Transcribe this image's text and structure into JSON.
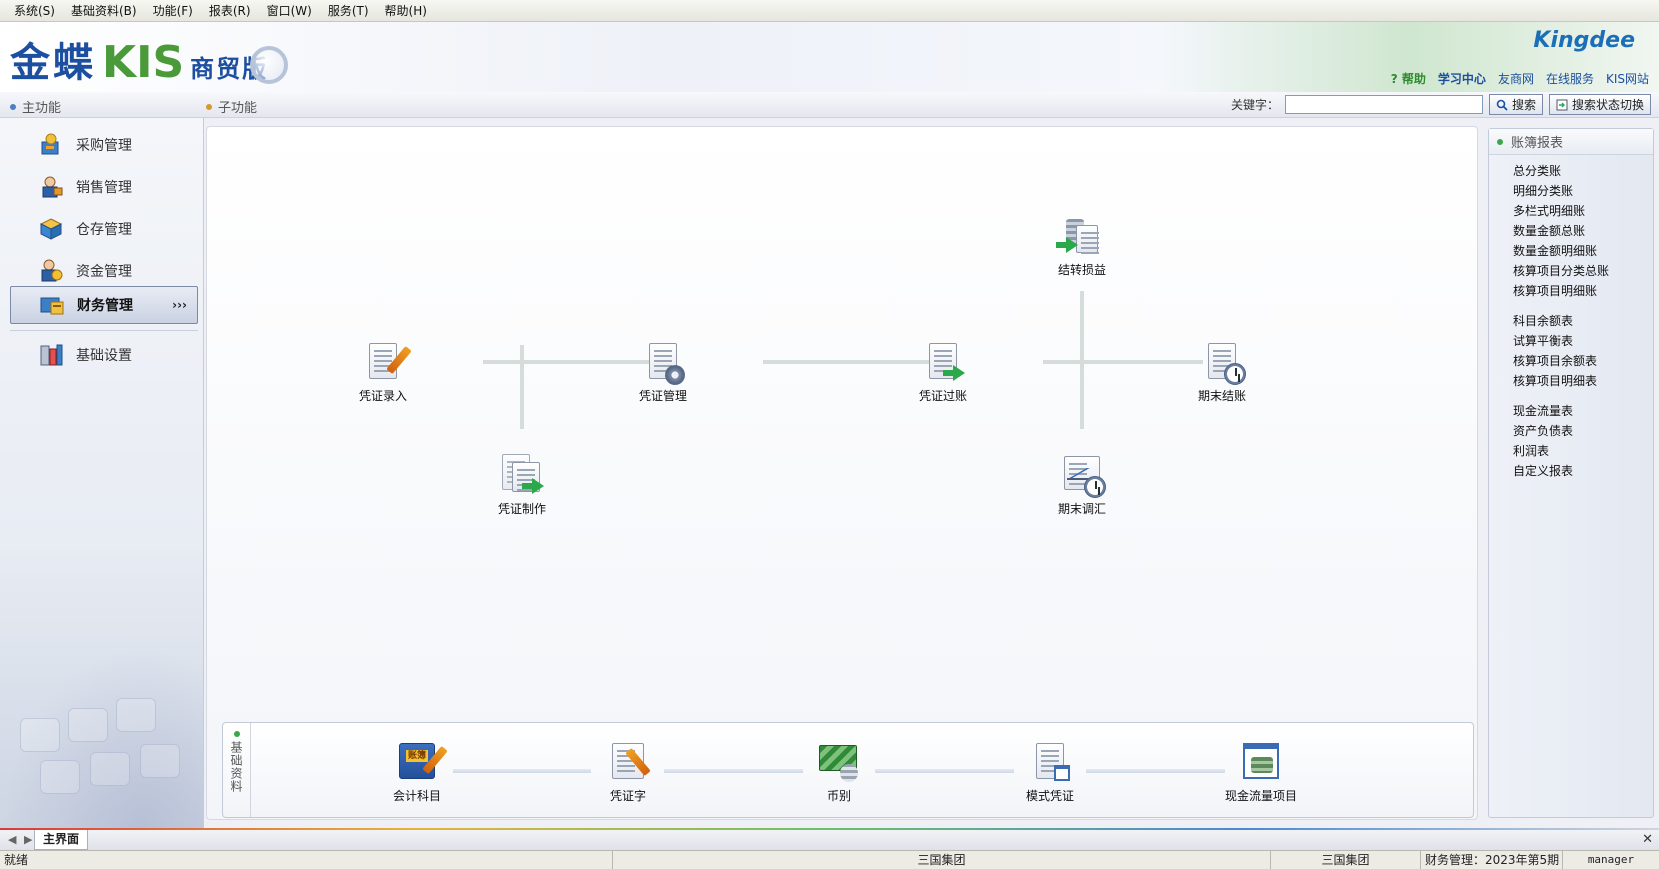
{
  "menu": [
    "系统(S)",
    "基础资料(B)",
    "功能(F)",
    "报表(R)",
    "窗口(W)",
    "服务(T)",
    "帮助(H)"
  ],
  "header": {
    "logo_main": "金蝶",
    "logo_kis": "KIS",
    "logo_edition": "商贸版",
    "brand": "Kingdee",
    "links": [
      "? 帮助",
      "学习中心",
      "友商网",
      "在线服务",
      "KIS网站"
    ]
  },
  "subbar": {
    "main_func": "主功能",
    "sub_func": "子功能",
    "keyword_label": "关键字：",
    "search_value": "",
    "search_button": "搜索",
    "toggle_button": "搜索状态切换"
  },
  "sidebar": {
    "items": [
      {
        "label": "采购管理",
        "icon": "purchase-icon"
      },
      {
        "label": "销售管理",
        "icon": "sales-icon"
      },
      {
        "label": "仓存管理",
        "icon": "inventory-icon"
      },
      {
        "label": "资金管理",
        "icon": "funds-icon"
      },
      {
        "label": "财务管理",
        "icon": "finance-icon",
        "active": true,
        "chevron": "›››"
      },
      {
        "label": "基础设置",
        "icon": "settings-icon"
      }
    ]
  },
  "flow": {
    "nodes": {
      "voucher_entry": "凭证录入",
      "voucher_make": "凭证制作",
      "voucher_manage": "凭证管理",
      "voucher_post": "凭证过账",
      "transfer_pl": "结转损益",
      "period_adjust": "期末调汇",
      "period_close": "期末结账"
    }
  },
  "base_data": {
    "title": "基础资料",
    "items": [
      "会计科目",
      "凭证字",
      "币别",
      "模式凭证",
      "现金流量项目"
    ],
    "book_text": "账簿"
  },
  "right_panel": {
    "title": "账簿报表",
    "groups": [
      [
        "总分类账",
        "明细分类账",
        "多栏式明细账",
        "数量金额总账",
        "数量金额明细账",
        "核算项目分类总账",
        "核算项目明细账"
      ],
      [
        "科目余额表",
        "试算平衡表",
        "核算项目余额表",
        "核算项目明细表"
      ],
      [
        "现金流量表",
        "资产负债表",
        "利润表",
        "自定义报表"
      ]
    ]
  },
  "tabbar": {
    "nav": "◀ ▶",
    "tab": "主界面",
    "close": "✕"
  },
  "status": {
    "ready": "就绪",
    "company1": "三国集团",
    "company2": "三国集团",
    "period": "财务管理：2023年第5期",
    "user": "manager"
  },
  "colors": {
    "accent_blue": "#1d4fa0",
    "accent_green": "#4a9a3a",
    "flow_line": "#d4ddd8"
  }
}
